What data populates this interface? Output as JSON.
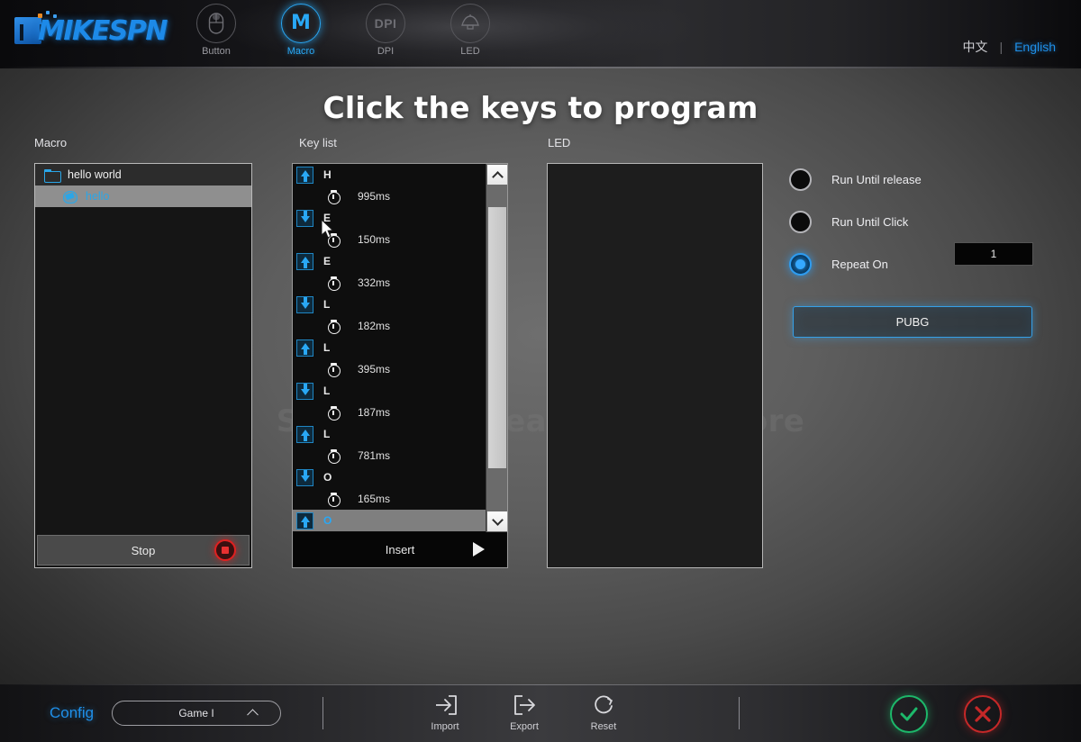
{
  "header": {
    "logo_text": "MIKESPN",
    "nav": [
      {
        "label": "Button",
        "icon": "mouse-icon",
        "active": false
      },
      {
        "label": "Macro",
        "icon": "macro-m-icon",
        "active": true
      },
      {
        "label": "DPI",
        "icon": "dpi-icon",
        "active": false
      },
      {
        "label": "LED",
        "icon": "led-lamp-icon",
        "active": false
      }
    ],
    "lang_cn": "中文",
    "lang_sep": "|",
    "lang_en": "English",
    "accent_color": "#29a8f5"
  },
  "page_title": "Click the keys to program",
  "watermark": "Shenzhen Icreat Co.,Ltd Store",
  "sections": {
    "macro_label": "Macro",
    "keylist_label": "Key list",
    "led_label": "LED"
  },
  "macro_panel": {
    "tree": [
      {
        "label": "hello world",
        "type": "folder",
        "selected": false
      },
      {
        "label": "hello",
        "type": "macro",
        "selected": true
      }
    ],
    "stop_label": "Stop",
    "record_color": "#e02020"
  },
  "key_list": {
    "rows": [
      {
        "kind": "key",
        "direction": "up",
        "char": "H",
        "selected": false
      },
      {
        "kind": "delay",
        "value": "995ms"
      },
      {
        "kind": "key",
        "direction": "down",
        "char": "E",
        "selected": false
      },
      {
        "kind": "delay",
        "value": "150ms"
      },
      {
        "kind": "key",
        "direction": "up",
        "char": "E",
        "selected": false
      },
      {
        "kind": "delay",
        "value": "332ms"
      },
      {
        "kind": "key",
        "direction": "down",
        "char": "L",
        "selected": false
      },
      {
        "kind": "delay",
        "value": "182ms"
      },
      {
        "kind": "key",
        "direction": "up",
        "char": "L",
        "selected": false
      },
      {
        "kind": "delay",
        "value": "395ms"
      },
      {
        "kind": "key",
        "direction": "down",
        "char": "L",
        "selected": false
      },
      {
        "kind": "delay",
        "value": "187ms"
      },
      {
        "kind": "key",
        "direction": "up",
        "char": "L",
        "selected": false
      },
      {
        "kind": "delay",
        "value": "781ms"
      },
      {
        "kind": "key",
        "direction": "down",
        "char": "O",
        "selected": false
      },
      {
        "kind": "delay",
        "value": "165ms"
      },
      {
        "kind": "key",
        "direction": "up",
        "char": "O",
        "selected": true
      }
    ],
    "insert_label": "Insert",
    "scroll_up_icon": "chevron-up-icon",
    "scroll_down_icon": "chevron-down-icon"
  },
  "options": {
    "items": [
      {
        "label": "Run Until release",
        "checked": false
      },
      {
        "label": "Run Until Click",
        "checked": false
      },
      {
        "label": "Repeat On",
        "checked": true
      }
    ],
    "repeat_value": "1",
    "profile_button": "PUBG",
    "selected_color": "#35a8ff"
  },
  "footer": {
    "config_label": "Config",
    "config_value": "Game I",
    "tools": [
      {
        "label": "Import",
        "icon": "import-arrow-icon"
      },
      {
        "label": "Export",
        "icon": "export-arrow-icon"
      },
      {
        "label": "Reset",
        "icon": "reset-circle-icon"
      }
    ],
    "confirm": {
      "ok_icon": "check-circle-icon",
      "cancel_icon": "x-circle-icon",
      "ok_color": "#1db86a",
      "cancel_color": "#c62828"
    }
  }
}
